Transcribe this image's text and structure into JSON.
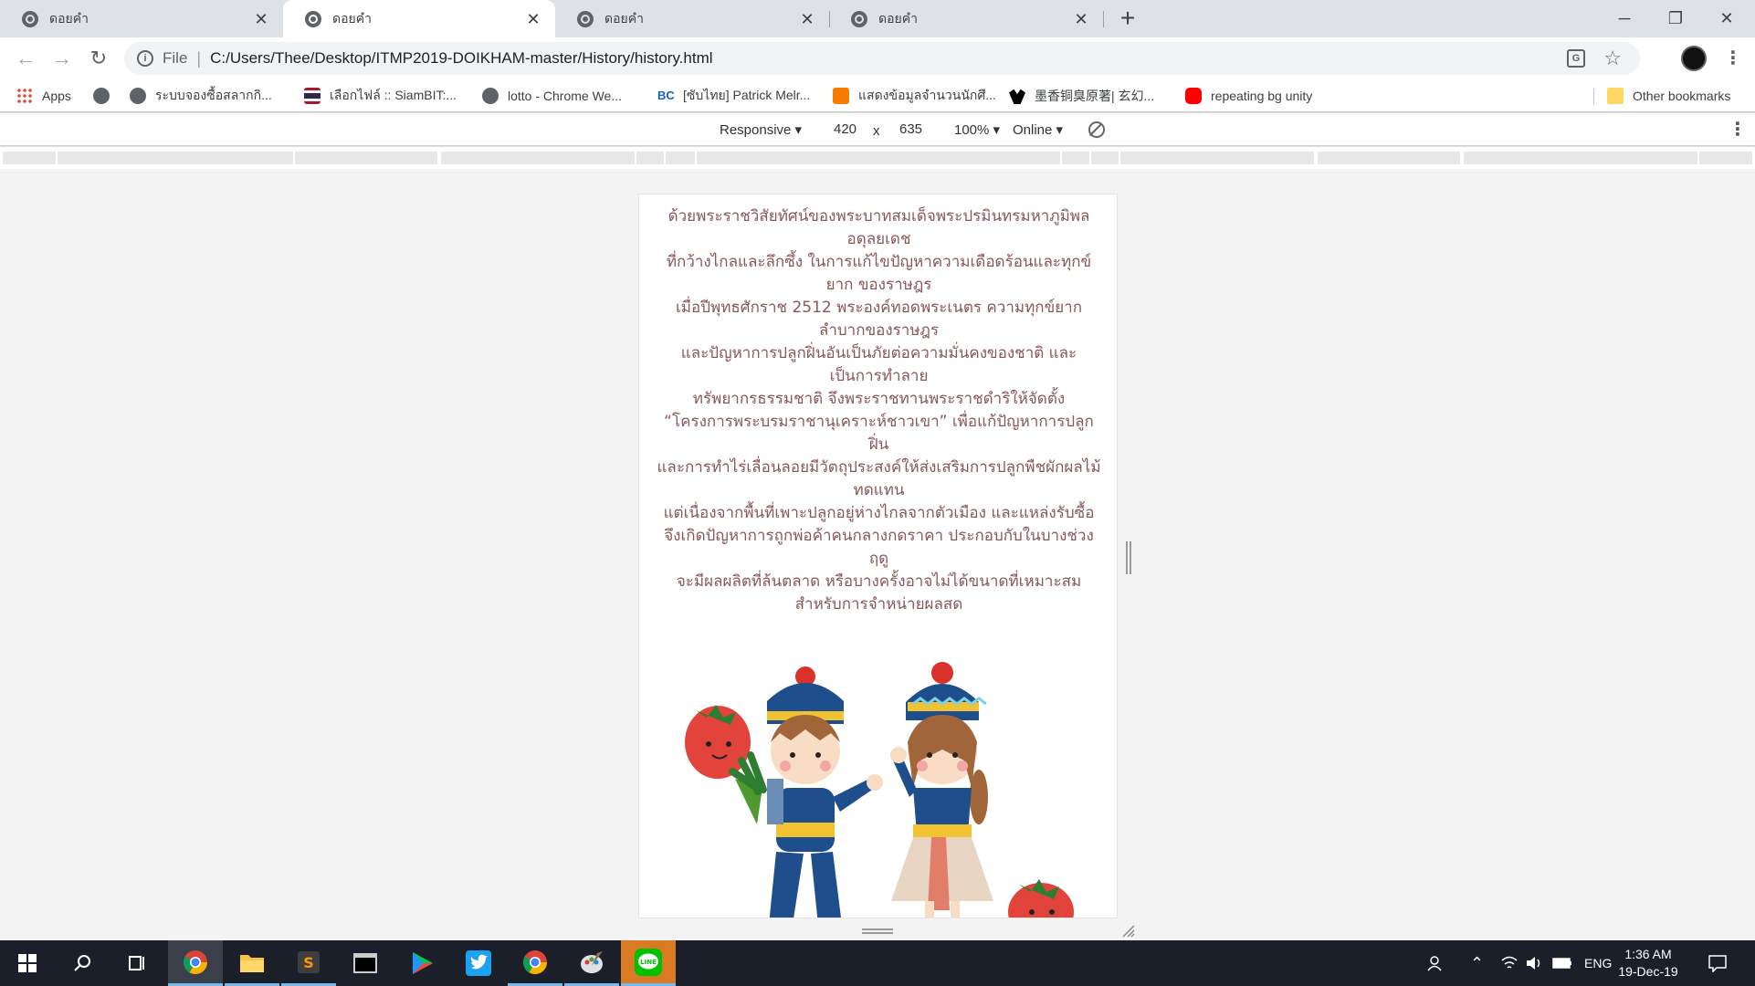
{
  "browser": {
    "tabs": [
      {
        "title": "ดอยคำ",
        "active": false
      },
      {
        "title": "ดอยคำ",
        "active": true
      },
      {
        "title": "ดอยคำ",
        "active": false
      },
      {
        "title": "ดอยคำ",
        "active": false
      }
    ],
    "address": {
      "scheme": "File",
      "url": "C:/Users/Thee/Desktop/ITMP2019-DOIKHAM-master/History/history.html"
    },
    "bookmarks": [
      {
        "label": "Apps",
        "icon": "apps-grid-icon"
      },
      {
        "label": "",
        "icon": "globe-icon"
      },
      {
        "label": "ระบบจองซื้อสลากกิ...",
        "icon": "globe-icon"
      },
      {
        "label": "เลือกไฟล์ :: SiamBIT:...",
        "icon": "thai-flag-icon"
      },
      {
        "label": "lotto - Chrome We...",
        "icon": "globe-icon"
      },
      {
        "label": "[ซับไทย] Patrick Melr...",
        "icon": "bc-icon"
      },
      {
        "label": "แสดงข้อมูลจำนวนนักศึ...",
        "icon": "orange-site-icon"
      },
      {
        "label": "墨香铜臭原著| 玄幻...",
        "icon": "bat-icon"
      },
      {
        "label": "repeating bg unity",
        "icon": "youtube-icon"
      }
    ],
    "other_bookmarks": "Other bookmarks"
  },
  "devtools": {
    "device": "Responsive",
    "width": "420",
    "times": "x",
    "height": "635",
    "zoom": "100%",
    "network": "Online"
  },
  "page": {
    "history_lines": [
      "ด้วยพระราชวิสัยทัศน์ของพระบาทสมเด็จพระปรมินทรมหาภูมิพลอดุลยเดช",
      "ที่กว้างไกลและลึกซึ้ง ในการแก้ไขปัญหาความเดือดร้อนและทุกข์ยาก ของราษฎร",
      "เมื่อปีพุทธศักราช 2512 พระองค์ทอดพระเนตร ความทุกข์ยากลำบากของราษฎร",
      "และปัญหาการปลูกฝิ่นอันเป็นภัยต่อความมั่นคงของชาติ และเป็นการทำลาย",
      "ทรัพยากรธรรมชาติ จึงพระราชทานพระราชดำริให้จัดตั้ง",
      "“โครงการพระบรมราชานุเคราะห์ชาวเขา” เพื่อแก้ปัญหาการปลูกฝิ่น",
      "และการทำไร่เลื่อนลอยมีวัตถุประสงค์ให้ส่งเสริมการปลูกพืชผักผลไม้ ทดแทน",
      "แต่เนื่องจากพื้นที่เพาะปลูกอยู่ห่างไกลจากตัวเมือง และแหล่งรับซื้อ",
      "จึงเกิดปัญหาการถูกพ่อค้าคนกลางกดราคา ประกอบกับในบางช่วงฤดู",
      "จะมีผลผลิตที่ล้นตลาด หรือบางครั้งอาจไม่ได้ขนาดที่เหมาะสมสำหรับการจำหน่ายผลสด"
    ]
  },
  "taskbar": {
    "language": "ENG",
    "time": "1:36 AM",
    "date": "19-Dec-19"
  }
}
